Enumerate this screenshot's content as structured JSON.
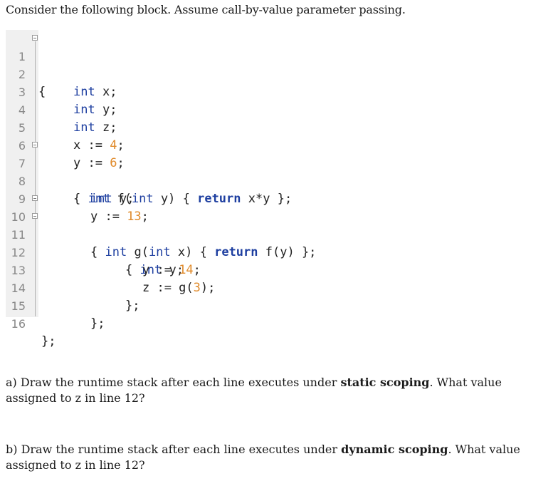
{
  "intro": "Consider the following block. Assume call-by-value parameter passing.",
  "code": {
    "lines": [
      {
        "n": "1",
        "t": "{"
      },
      {
        "n": "2",
        "t": "int x;"
      },
      {
        "n": "3",
        "t": "int y;"
      },
      {
        "n": "4",
        "t": "int z;"
      },
      {
        "n": "5",
        "t": "x := 4;"
      },
      {
        "n": "6",
        "t": "y := 6;"
      },
      {
        "n": "7",
        "t": "{ int f(int y) { return x*y };"
      },
      {
        "n": "8",
        "t": "int y;"
      },
      {
        "n": "9",
        "t": "y := 13;"
      },
      {
        "n": "10",
        "t": "{ int g(int x) { return f(y) };"
      },
      {
        "n": "11",
        "t": "{ int y;"
      },
      {
        "n": "12",
        "t": "y := 14;"
      },
      {
        "n": "13",
        "t": "z := g(3);"
      },
      {
        "n": "14",
        "t": "};"
      },
      {
        "n": "15",
        "t": "};"
      },
      {
        "n": "16",
        "t": "};"
      }
    ]
  },
  "questions": {
    "a": {
      "pre": "a) Draw the runtime stack after each line executes under ",
      "bold": "static scoping",
      "post": ". What value assigned to z in line 12?"
    },
    "b": {
      "pre": "b) Draw the runtime stack after each line executes under ",
      "bold": "dynamic scoping",
      "post": ". What value assigned to z in line 12?"
    }
  }
}
